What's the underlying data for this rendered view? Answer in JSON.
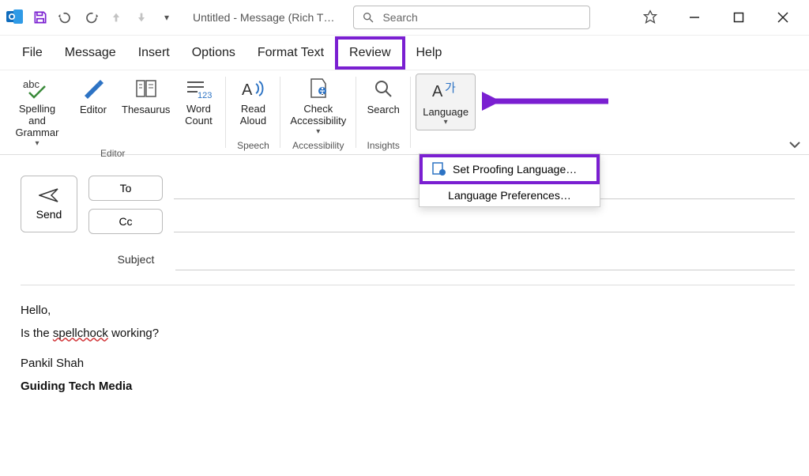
{
  "titlebar": {
    "title": "Untitled  -  Message (Rich T…",
    "search_placeholder": "Search"
  },
  "tabs": [
    "File",
    "Message",
    "Insert",
    "Options",
    "Format Text",
    "Review",
    "Help"
  ],
  "active_tab": "Review",
  "ribbon": {
    "spelling": "Spelling and\nGrammar",
    "editor": "Editor",
    "thesaurus": "Thesaurus",
    "wordcount": "Word\nCount",
    "readaloud": "Read\nAloud",
    "checkacc": "Check\nAccessibility",
    "search": "Search",
    "language": "Language",
    "groups": {
      "editor": "Editor",
      "speech": "Speech",
      "accessibility": "Accessibility",
      "insights": "Insights"
    }
  },
  "popup": {
    "item1": "Set Proofing Language…",
    "item2": "Language Preferences…"
  },
  "compose": {
    "send": "Send",
    "to": "To",
    "cc": "Cc",
    "subject": "Subject"
  },
  "body": {
    "l1": "Hello,",
    "l2a": "Is the ",
    "l2b": "spellchock",
    "l2c": " working?",
    "sig1": "Pankil Shah",
    "sig2": "Guiding Tech Media"
  },
  "colors": {
    "accent": "#7a1fd1"
  }
}
